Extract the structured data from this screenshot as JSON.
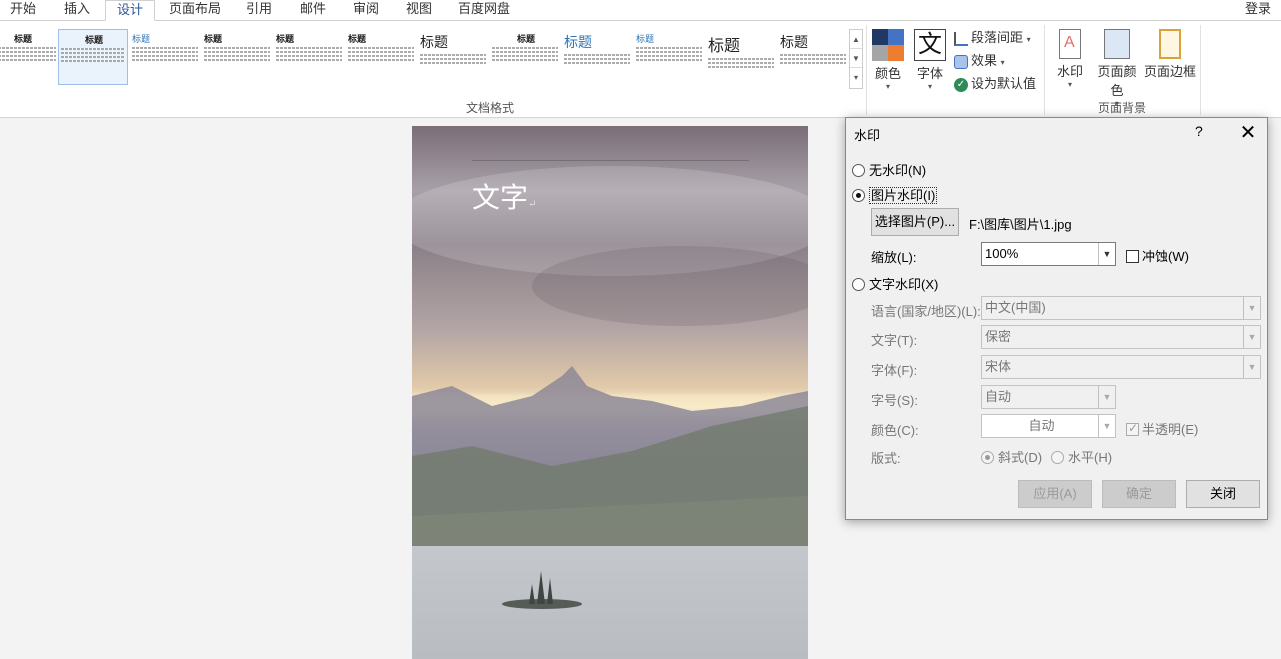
{
  "tabs": [
    {
      "label": "开始"
    },
    {
      "label": "插入"
    },
    {
      "label": "设计"
    },
    {
      "label": "页面布局"
    },
    {
      "label": "引用"
    },
    {
      "label": "邮件"
    },
    {
      "label": "审阅"
    },
    {
      "label": "视图"
    },
    {
      "label": "百度网盘"
    }
  ],
  "active_tab": "设计",
  "login_label": "登录",
  "ribbon": {
    "document_format_group": "文档格式",
    "style_gallery": [
      {
        "title": "标题"
      },
      {
        "title": "标题"
      },
      {
        "title": "标题"
      },
      {
        "title": "标题"
      },
      {
        "title": "标题"
      },
      {
        "title": "标题"
      },
      {
        "title": "标题"
      },
      {
        "title": "标题"
      },
      {
        "title": "标题"
      },
      {
        "title": "标题"
      },
      {
        "title": "标题"
      },
      {
        "title": "标题"
      }
    ],
    "colors_label": "颜色",
    "fonts_label": "字体",
    "fonts_icon_char": "文",
    "paragraph_spacing_label": "段落间距",
    "effects_label": "效果",
    "set_default_label": "设为默认值",
    "page_background_group": "页面背景",
    "watermark_label": "水印",
    "page_color_label": "页面颜色",
    "page_border_label": "页面边框"
  },
  "document": {
    "text": "文字",
    "para_mark": "↵"
  },
  "dialog": {
    "title": "水印",
    "help": "?",
    "close": "✕",
    "no_watermark": "无水印(N)",
    "picture_watermark": "图片水印(I)",
    "select_picture": "选择图片(P)...",
    "picture_path": "F:\\图库\\图片\\1.jpg",
    "scale_label": "缩放(L):",
    "scale_value": "100%",
    "washout_label": "冲蚀(W)",
    "text_watermark": "文字水印(X)",
    "language_label": "语言(国家/地区)(L):",
    "language_value": "中文(中国)",
    "text_label": "文字(T):",
    "text_value": "保密",
    "font_label": "字体(F):",
    "font_value": "宋体",
    "size_label": "字号(S):",
    "size_value": "自动",
    "color_label": "颜色(C):",
    "color_value": "自动",
    "semi_transparent_label": "半透明(E)",
    "layout_label": "版式:",
    "diagonal_label": "斜式(D)",
    "horizontal_label": "水平(H)",
    "apply_label": "应用(A)",
    "ok_label": "确定",
    "close_label": "关闭"
  },
  "colors": {
    "accent": "#2b579a",
    "swatch_dark": "#1f3864",
    "swatch_orange": "#ed7d31",
    "swatch_blue": "#4472c4",
    "swatch_gray": "#a5a5a5"
  }
}
